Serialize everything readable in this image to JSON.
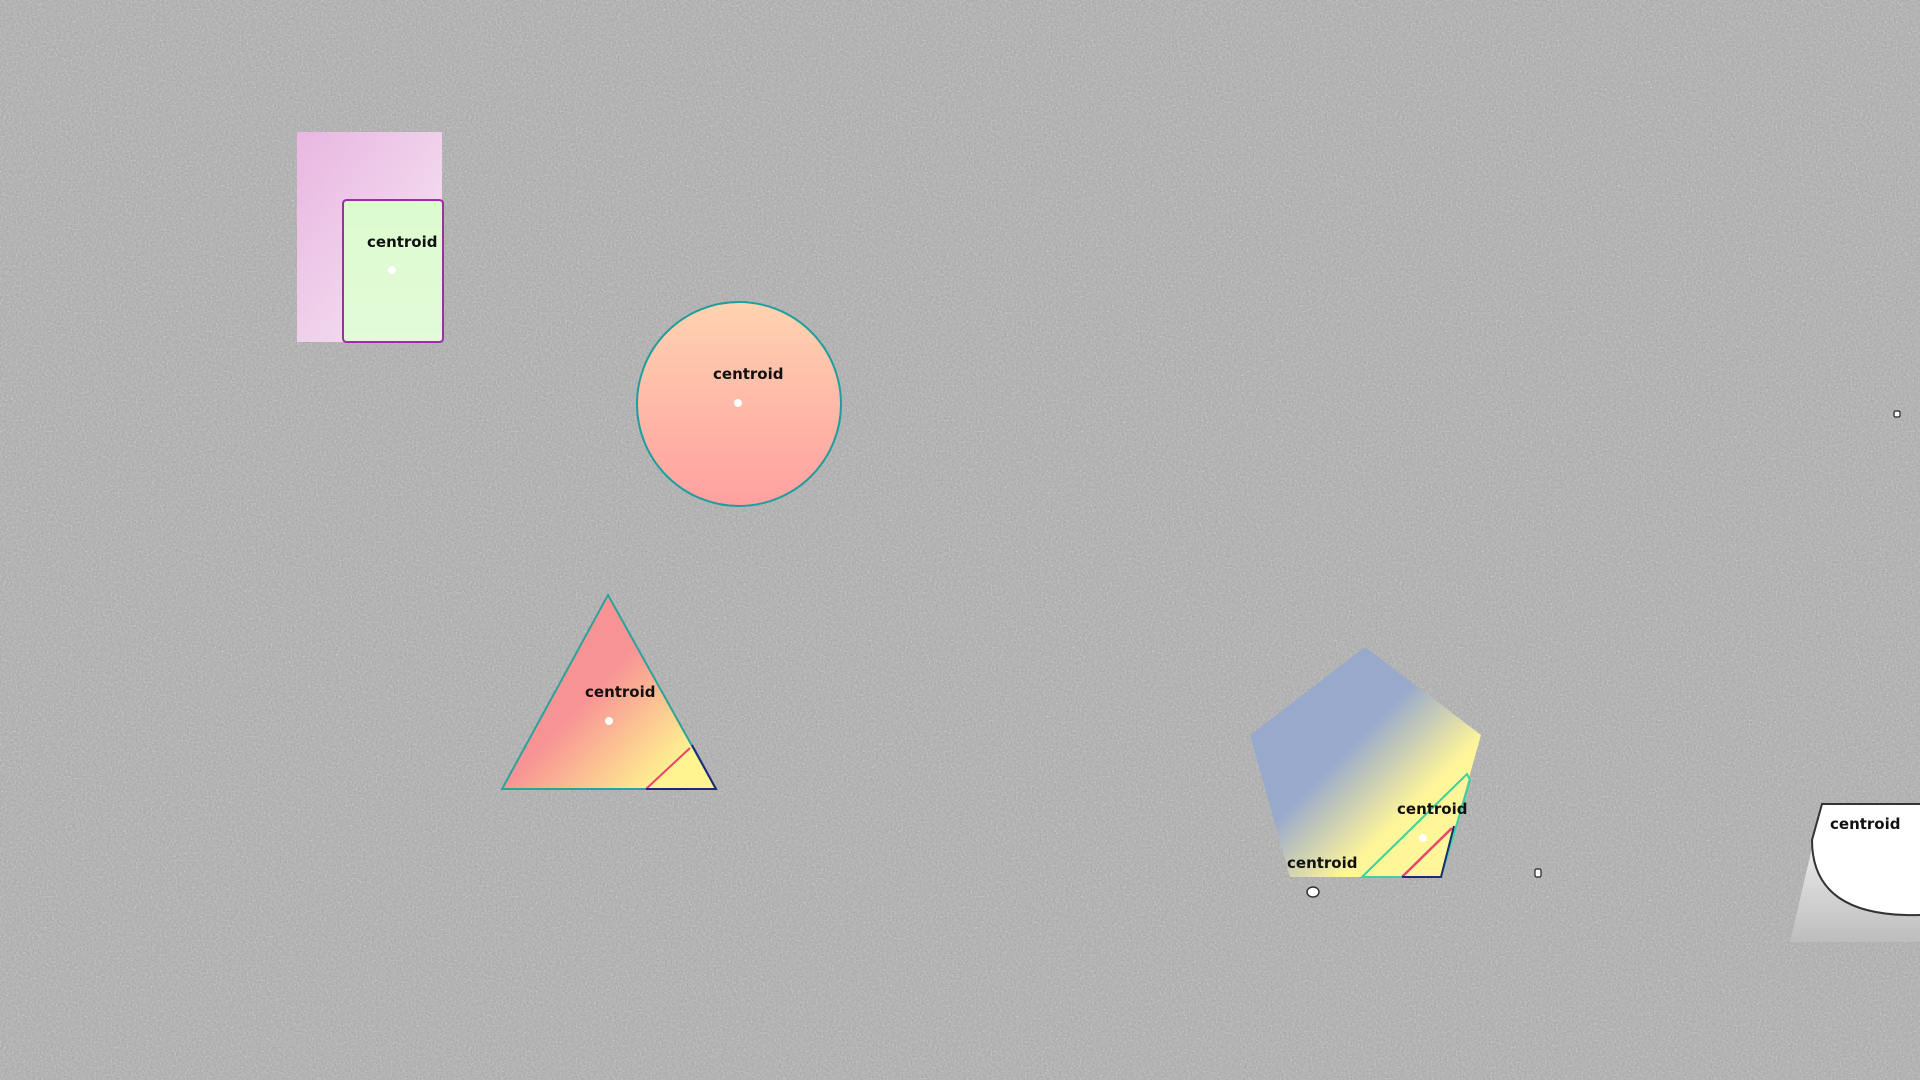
{
  "scene": {
    "background_color": "#a7a7a7",
    "centroid_label": "centroid",
    "shapes": [
      {
        "id": "rectangle",
        "kind": "rectangle",
        "label": "centroid",
        "fill_colors": [
          "#e9b6e2",
          "#dcfbd0"
        ],
        "contour_color": "#9b2fa3"
      },
      {
        "id": "circle",
        "kind": "circle",
        "label": "centroid",
        "fill_colors": [
          "#ffcfae",
          "#ffa3a3"
        ],
        "contour_color": "#1f9e9e"
      },
      {
        "id": "triangle",
        "kind": "triangle",
        "label": "centroid",
        "fill_colors": [
          "#f89395",
          "#fff490"
        ],
        "contour_color": "#2aa39a",
        "inner_contours": [
          "#e8456e",
          "#1d2a7a"
        ]
      },
      {
        "id": "pentagon",
        "kind": "pentagon",
        "labels": [
          "centroid",
          "centroid"
        ],
        "fill_colors": [
          "#98a9cc",
          "#fff69a"
        ],
        "inner_contours": [
          "#39d49a",
          "#e8456e",
          "#1d2a7a"
        ]
      },
      {
        "id": "partial-circle",
        "kind": "arc",
        "label": "centroid",
        "fill_colors": [
          "#ffffff",
          "#bdbdbd"
        ],
        "contour_color": "#333333"
      }
    ]
  }
}
